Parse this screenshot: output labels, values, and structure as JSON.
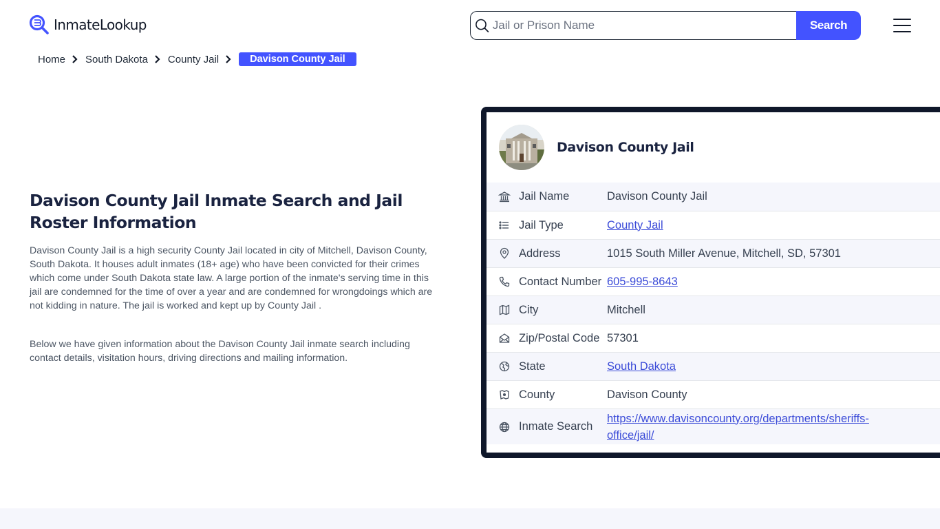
{
  "header": {
    "logo_text": "InmateLookup",
    "search_placeholder": "Jail or Prison Name",
    "search_value": "",
    "search_button": "Search",
    "brand_color": "#4353ff"
  },
  "breadcrumb": {
    "items": [
      "Home",
      "South Dakota",
      "County Jail"
    ],
    "active": "Davison County Jail"
  },
  "main": {
    "title": "Davison County Jail Inmate Search and Jail Roster Information",
    "paragraphs": [
      "Davison County Jail is a high security County Jail located in city of Mitchell, Davison County, South Dakota. It houses adult inmates (18+ age) who have been convicted for their crimes which come under South Dakota state law. A large portion of the inmate's serving time in this jail are condemned for the time of over a year and are condemned for wrongdoings which are not kidding in nature. The jail is worked and kept up by County Jail .",
      "Below we have given information about the Davison County Jail inmate search including contact details, visitation hours, driving directions and mailing information."
    ]
  },
  "card": {
    "title": "Davison County Jail",
    "rows": [
      {
        "icon": "bank-icon",
        "label": "Jail Name",
        "value": "Davison County Jail",
        "link": false
      },
      {
        "icon": "list-icon",
        "label": "Jail Type",
        "value": "County Jail",
        "link": true
      },
      {
        "icon": "map-pin-icon",
        "label": "Address",
        "value": "1015 South Miller Avenue, Mitchell, SD, 57301",
        "link": false
      },
      {
        "icon": "phone-icon",
        "label": "Contact Number",
        "value": "605-995-8643",
        "link": true
      },
      {
        "icon": "map-icon",
        "label": "City",
        "value": "Mitchell",
        "link": false
      },
      {
        "icon": "mail-open-icon",
        "label": "Zip/Postal Code",
        "value": "57301",
        "link": false
      },
      {
        "icon": "globe-state-icon",
        "label": "State",
        "value": "South Dakota",
        "link": true
      },
      {
        "icon": "county-map-icon",
        "label": "County",
        "value": "Davison County",
        "link": false
      },
      {
        "icon": "globe-icon",
        "label": "Inmate Search",
        "value": "https://www.davisoncounty.org/departments/sheriffs-office/jail/",
        "value_line1": "https://www.davisoncounty.org/departments/sheriffs-",
        "value_line2": "office/jail/",
        "link": true
      }
    ]
  }
}
